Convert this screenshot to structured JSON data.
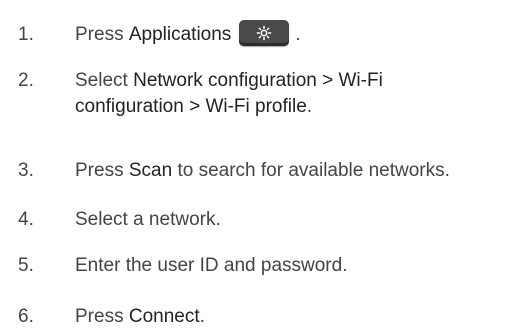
{
  "steps": [
    {
      "number": "1.",
      "text_before": "Press ",
      "bold": "Applications",
      "icon": "gear-icon",
      "text_after": "."
    },
    {
      "number": "2.",
      "text_before": "Select ",
      "bold_line1": "Network configuration > Wi-Fi",
      "bold_line2": "configuration > Wi-Fi profile",
      "text_after": "."
    },
    {
      "number": "3.",
      "text_before": "Press ",
      "bold": "Scan",
      "text_after": " to search for available networks."
    },
    {
      "number": "4.",
      "text": "Select a network."
    },
    {
      "number": "5.",
      "text": "Enter the user ID and password."
    },
    {
      "number": "6.",
      "text_before": "Press ",
      "bold": "Connect",
      "text_after": "."
    }
  ],
  "colors": {
    "text": "#444444",
    "emphasis": "#222222",
    "key_background": "#4a4a4a",
    "key_icon": "#ffffff"
  }
}
